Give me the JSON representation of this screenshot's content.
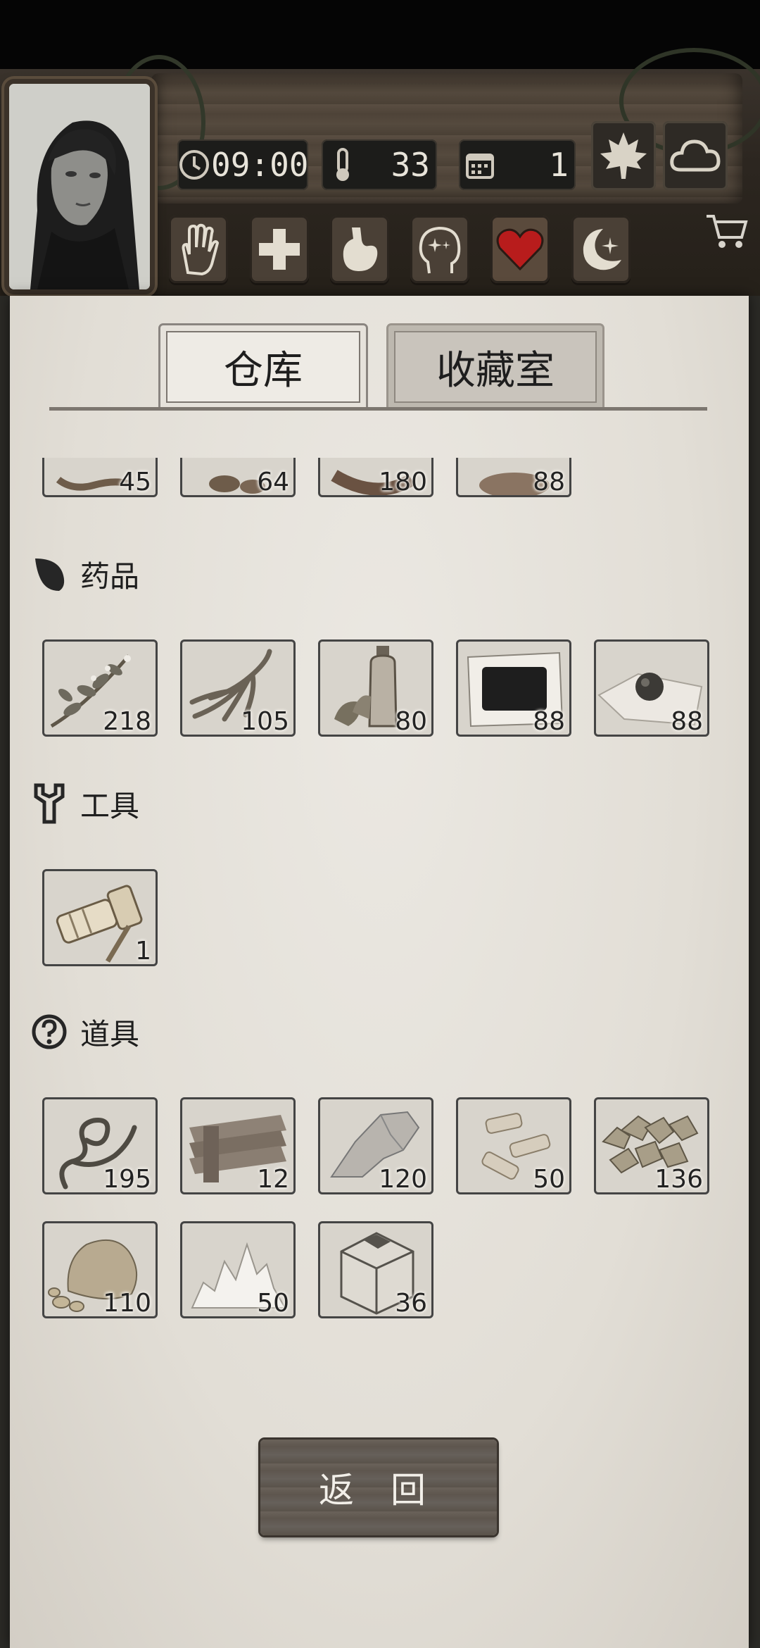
{
  "status": {
    "time": "09:00",
    "temperature": "33",
    "day": "1"
  },
  "tabs": [
    {
      "label": "仓库",
      "active": true
    },
    {
      "label": "收藏室",
      "active": false
    }
  ],
  "partial_row": {
    "counts": [
      "45",
      "64",
      "180",
      "88"
    ]
  },
  "sections": [
    {
      "title": "药品",
      "icon": "herb-leaf-icon",
      "items": [
        {
          "name": "herb-branch-item",
          "count": "218"
        },
        {
          "name": "ginseng-root-item",
          "count": "105"
        },
        {
          "name": "medicine-bottle-item",
          "count": "80"
        },
        {
          "name": "plaster-patch-item",
          "count": "88"
        },
        {
          "name": "medicine-pill-item",
          "count": "88"
        }
      ]
    },
    {
      "title": "工具",
      "icon": "wrench-icon",
      "items": [
        {
          "name": "flashlight-item",
          "count": "1"
        }
      ]
    },
    {
      "title": "道具",
      "icon": "question-circle-icon",
      "items": [
        {
          "name": "vine-rope-item",
          "count": "195"
        },
        {
          "name": "wood-planks-item",
          "count": "12"
        },
        {
          "name": "stone-item",
          "count": "120"
        },
        {
          "name": "bone-pieces-item",
          "count": "50"
        },
        {
          "name": "ore-nuggets-item",
          "count": "136"
        },
        {
          "name": "rock-chunk-item",
          "count": "110"
        },
        {
          "name": "salt-crystal-item",
          "count": "50"
        },
        {
          "name": "box-item",
          "count": "36"
        }
      ]
    }
  ],
  "back_label": "返 回",
  "colors": {
    "heart": "#b81c1c",
    "paper": "#e4e0d8",
    "plank": "#4e4338"
  }
}
